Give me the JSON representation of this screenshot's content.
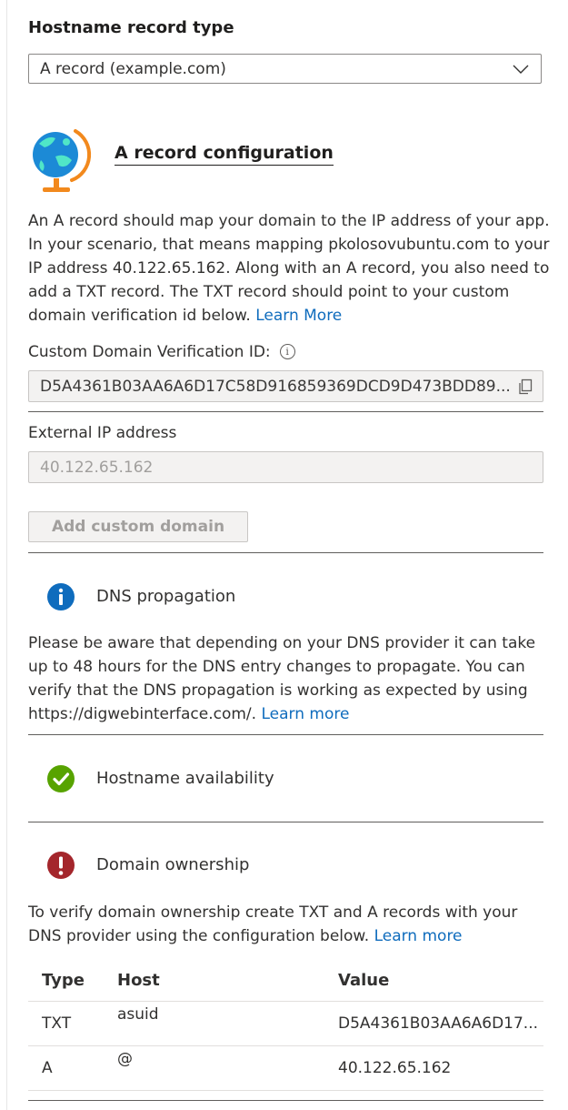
{
  "hostname_record_type": {
    "label": "Hostname record type",
    "selected": "A record (example.com)"
  },
  "a_record_config": {
    "title": "A record configuration",
    "description": "An A record should map your domain to the IP address of your app. In your scenario, that means mapping pkolosovubuntu.com to your IP address 40.122.65.162. Along with an A record, you also need to add a TXT record. The TXT record should point to your custom domain verification id below.",
    "learn_more": "Learn More"
  },
  "verification": {
    "label": "Custom Domain Verification ID:",
    "value": "D5A4361B03AA6A6D17C58D916859369DCD9D473BDD89..."
  },
  "external_ip": {
    "label": "External IP address",
    "value": "40.122.65.162"
  },
  "add_button": {
    "label": "Add custom domain"
  },
  "dns_propagation": {
    "title": "DNS propagation",
    "description": "Please be aware that depending on your DNS provider it can take up to 48 hours for the DNS entry changes to propagate. You can verify that the DNS propagation is working as expected by using https://digwebinterface.com/.",
    "learn_more": "Learn more"
  },
  "hostname_availability": {
    "title": "Hostname availability"
  },
  "domain_ownership": {
    "title": "Domain ownership",
    "description": "To verify domain ownership create TXT and A records with your DNS provider using the configuration below.",
    "learn_more": "Learn more"
  },
  "records_table": {
    "headers": [
      "Type",
      "Host",
      "Value"
    ],
    "rows": [
      [
        "TXT",
        "asuid",
        "D5A4361B03AA6A6D17..."
      ],
      [
        "A",
        "@",
        "40.122.65.162"
      ]
    ]
  },
  "colors": {
    "link": "#0f6cbd",
    "info": "#0f6cbd",
    "success": "#57a300",
    "error": "#a4262c"
  }
}
